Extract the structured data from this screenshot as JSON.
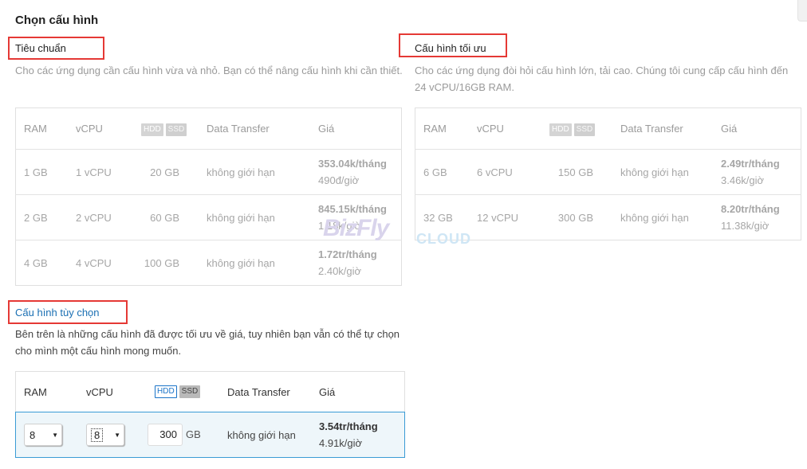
{
  "page": {
    "title": "Chọn cấu hình"
  },
  "standard": {
    "heading": "Tiêu chuẩn",
    "description": "Cho các ứng dụng cần cấu hình vừa và nhỏ. Bạn có thể nâng cấu hình khi cần thiết.",
    "columns": {
      "ram": "RAM",
      "vcpu": "vCPU",
      "hdd": "HDD",
      "ssd": "SSD",
      "transfer": "Data Transfer",
      "price": "Giá"
    },
    "rows": [
      {
        "ram": "1 GB",
        "vcpu": "1 vCPU",
        "disk": "20 GB",
        "transfer": "không giới hạn",
        "price_month": "353.04k/tháng",
        "price_hour": "490đ/giờ"
      },
      {
        "ram": "2 GB",
        "vcpu": "2 vCPU",
        "disk": "60 GB",
        "transfer": "không giới hạn",
        "price_month": "845.15k/tháng",
        "price_hour": "1.18k/giờ"
      },
      {
        "ram": "4 GB",
        "vcpu": "4 vCPU",
        "disk": "100 GB",
        "transfer": "không giới hạn",
        "price_month": "1.72tr/tháng",
        "price_hour": "2.40k/giờ"
      }
    ]
  },
  "optimized": {
    "heading": "Cấu hình tối ưu",
    "description": "Cho các ứng dụng đòi hỏi cấu hình lớn, tải cao. Chúng tôi cung cấp cấu hình đến 24 vCPU/16GB RAM.",
    "columns": {
      "ram": "RAM",
      "vcpu": "vCPU",
      "hdd": "HDD",
      "ssd": "SSD",
      "transfer": "Data Transfer",
      "price": "Giá"
    },
    "rows": [
      {
        "ram": "6 GB",
        "vcpu": "6 vCPU",
        "disk": "150 GB",
        "transfer": "không giới hạn",
        "price_month": "2.49tr/tháng",
        "price_hour": "3.46k/giờ"
      },
      {
        "ram": "32 GB",
        "vcpu": "12 vCPU",
        "disk": "300 GB",
        "transfer": "không giới hạn",
        "price_month": "8.20tr/tháng",
        "price_hour": "11.38k/giờ"
      }
    ]
  },
  "custom": {
    "heading": "Cấu hình tùy chọn",
    "description": "Bên trên là những cấu hình đã được tối ưu về giá, tuy nhiên bạn vẫn có thể tự chọn cho mình một cấu hình mong muốn.",
    "columns": {
      "ram": "RAM",
      "vcpu": "vCPU",
      "hdd": "HDD",
      "ssd": "SSD",
      "transfer": "Data Transfer",
      "price": "Giá"
    },
    "row": {
      "ram_value": "8",
      "vcpu_value": "8",
      "disk_value": "300",
      "disk_unit": "GB",
      "transfer": "không giới hạn",
      "price_month": "3.54tr/tháng",
      "price_hour": "4.91k/giờ"
    }
  },
  "watermark": {
    "brand": "BizFly",
    "suffix": "CLOUD"
  },
  "colors": {
    "highlight_border": "#e53935",
    "accent": "#1a73c8",
    "selected_row_bg": "#eef6fa"
  }
}
